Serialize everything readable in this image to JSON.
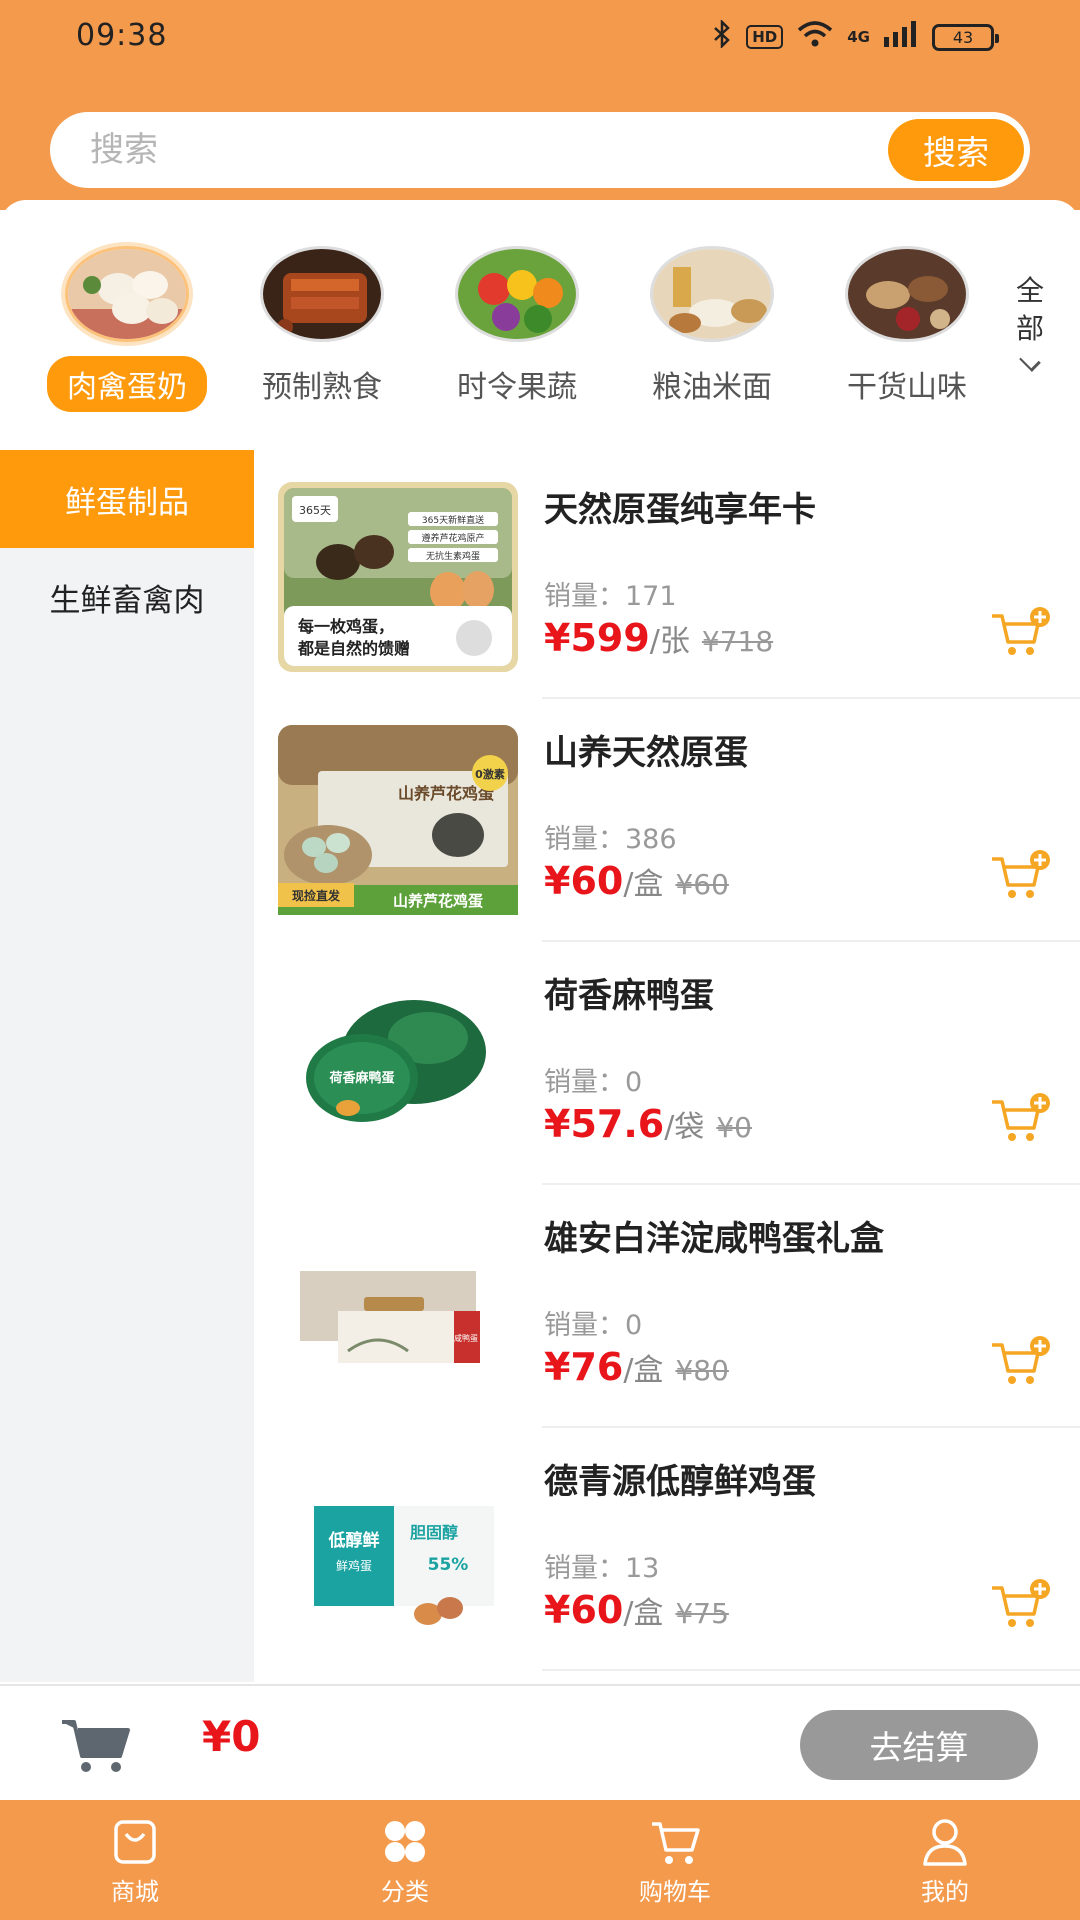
{
  "status_bar": {
    "time": "09:38",
    "network": "4G",
    "battery": "43"
  },
  "search": {
    "placeholder": "搜索",
    "button_label": "搜索"
  },
  "categories": [
    {
      "label": "肉禽蛋奶",
      "active": true
    },
    {
      "label": "预制熟食",
      "active": false
    },
    {
      "label": "时令果蔬",
      "active": false
    },
    {
      "label": "粮油米面",
      "active": false
    },
    {
      "label": "干货山味",
      "active": false
    }
  ],
  "categories_all": {
    "line1": "全",
    "line2": "部"
  },
  "sidebar": {
    "items": [
      {
        "label": "鲜蛋制品",
        "active": true
      },
      {
        "label": "生鲜畜禽肉",
        "active": false
      }
    ]
  },
  "products": [
    {
      "name": "天然原蛋纯享年卡",
      "sales_label": "销量：",
      "sales": "171",
      "price": "¥599",
      "unit": "/张",
      "original_price": "¥718",
      "image_text": {
        "tl": "365天",
        "l1": "365天新鲜直送",
        "l2": "遵养芦花鸡原产",
        "l3": "无抗生素鸡蛋",
        "c1": "每一枚鸡蛋，",
        "c2": "都是自然的馈赠"
      }
    },
    {
      "name": "山养天然原蛋",
      "sales_label": "销量：",
      "sales": "386",
      "price": "¥60",
      "unit": "/盒",
      "original_price": "¥60",
      "image_text": {
        "box": "山养芦花鸡蛋",
        "badge": "0激素",
        "tag": "现捡直发",
        "caption": "山养芦花鸡蛋"
      }
    },
    {
      "name": "荷香麻鸭蛋",
      "sales_label": "销量：",
      "sales": "0",
      "price": "¥57.6",
      "unit": "/袋",
      "original_price": "¥0",
      "image_text": {
        "label": "荷香麻鸭蛋"
      }
    },
    {
      "name": "雄安白洋淀咸鸭蛋礼盒",
      "sales_label": "销量：",
      "sales": "0",
      "price": "¥76",
      "unit": "/盒",
      "original_price": "¥80",
      "image_text": {
        "label": "咸鸭蛋"
      }
    },
    {
      "name": "德青源低醇鲜鸡蛋",
      "sales_label": "销量：",
      "sales": "13",
      "price": "¥60",
      "unit": "/盒",
      "original_price": "¥75",
      "image_text": {
        "a": "低醇鲜",
        "b": "鲜鸡蛋",
        "c": "胆固醇",
        "d": "55%"
      }
    }
  ],
  "cart_summary": {
    "total": "¥0",
    "checkout_label": "去结算"
  },
  "tabbar": [
    {
      "label": "商城",
      "icon": "bag-icon"
    },
    {
      "label": "分类",
      "icon": "grid-icon"
    },
    {
      "label": "购物车",
      "icon": "cart-icon"
    },
    {
      "label": "我的",
      "icon": "user-icon"
    }
  ],
  "colors": {
    "header": "#F39A4C",
    "accent": "#FE9A0C",
    "price": "#E8151B",
    "checkout_disabled": "#999999",
    "sidebar_bg": "#F2F3F5"
  }
}
